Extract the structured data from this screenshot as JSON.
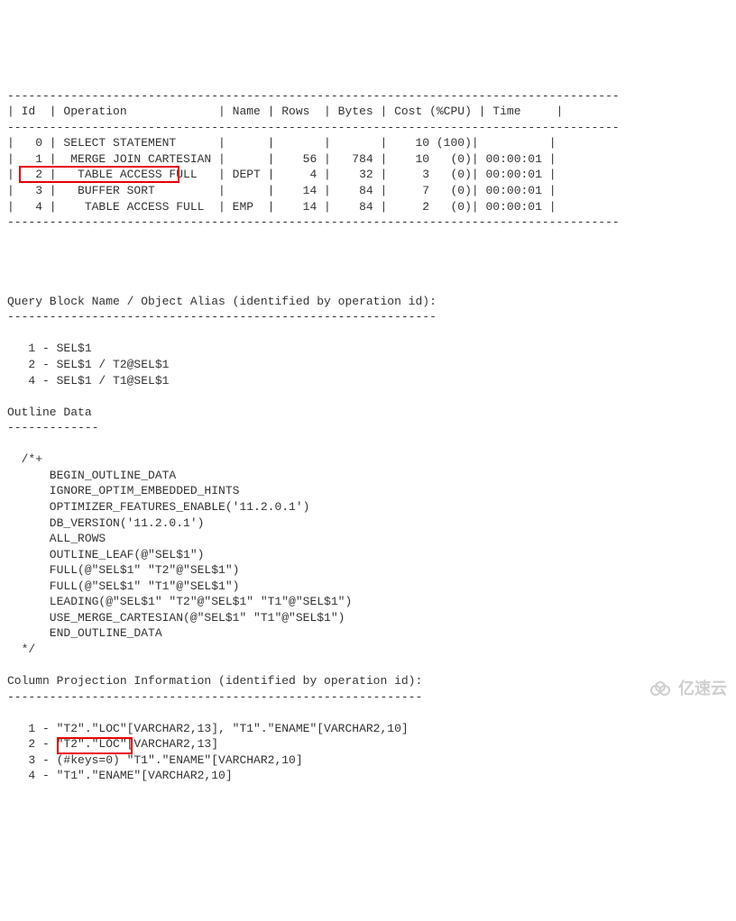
{
  "plan": {
    "header": {
      "cols": [
        "Id",
        "Operation",
        "Name",
        "Rows",
        "Bytes",
        "Cost (%CPU)",
        "Time"
      ]
    },
    "rows": [
      {
        "id": "0",
        "op": "SELECT STATEMENT",
        "name": "",
        "rows": "",
        "bytes": "",
        "cost": "10",
        "cpu": "(100)",
        "time": ""
      },
      {
        "id": "1",
        "op": " MERGE JOIN CARTESIAN",
        "name": "",
        "rows": "56",
        "bytes": "784",
        "cost": "10",
        "cpu": "(0)",
        "time": "00:00:01"
      },
      {
        "id": "2",
        "op": "  TABLE ACCESS FULL",
        "name": "DEPT",
        "rows": "4",
        "bytes": "32",
        "cost": "3",
        "cpu": "(0)",
        "time": "00:00:01"
      },
      {
        "id": "3",
        "op": "  BUFFER SORT",
        "name": "",
        "rows": "14",
        "bytes": "84",
        "cost": "7",
        "cpu": "(0)",
        "time": "00:00:01"
      },
      {
        "id": "4",
        "op": "   TABLE ACCESS FULL",
        "name": "EMP",
        "rows": "14",
        "bytes": "84",
        "cost": "2",
        "cpu": "(0)",
        "time": "00:00:01"
      }
    ]
  },
  "qb": {
    "title": "Query Block Name / Object Alias (identified by operation id):",
    "lines": [
      "1 - SEL$1",
      "2 - SEL$1 / T2@SEL$1",
      "4 - SEL$1 / T1@SEL$1"
    ]
  },
  "outline": {
    "title": "Outline Data",
    "open": "/*+",
    "hints": [
      "BEGIN_OUTLINE_DATA",
      "IGNORE_OPTIM_EMBEDDED_HINTS",
      "OPTIMIZER_FEATURES_ENABLE('11.2.0.1')",
      "DB_VERSION('11.2.0.1')",
      "ALL_ROWS",
      "OUTLINE_LEAF(@\"SEL$1\")",
      "FULL(@\"SEL$1\" \"T2\"@\"SEL$1\")",
      "FULL(@\"SEL$1\" \"T1\"@\"SEL$1\")",
      "LEADING(@\"SEL$1\" \"T2\"@\"SEL$1\" \"T1\"@\"SEL$1\")",
      "USE_MERGE_CARTESIAN(@\"SEL$1\" \"T1\"@\"SEL$1\")",
      "END_OUTLINE_DATA"
    ],
    "close": "*/"
  },
  "proj": {
    "title": "Column Projection Information (identified by operation id):",
    "lines": [
      "1 - \"T2\".\"LOC\"[VARCHAR2,13], \"T1\".\"ENAME\"[VARCHAR2,10]",
      "2 - \"T2\".\"LOC\"[VARCHAR2,13]",
      "3 - (#keys=0) \"T1\".\"ENAME\"[VARCHAR2,10]",
      "4 - \"T1\".\"ENAME\"[VARCHAR2,10]"
    ]
  },
  "watermark": "亿速云"
}
